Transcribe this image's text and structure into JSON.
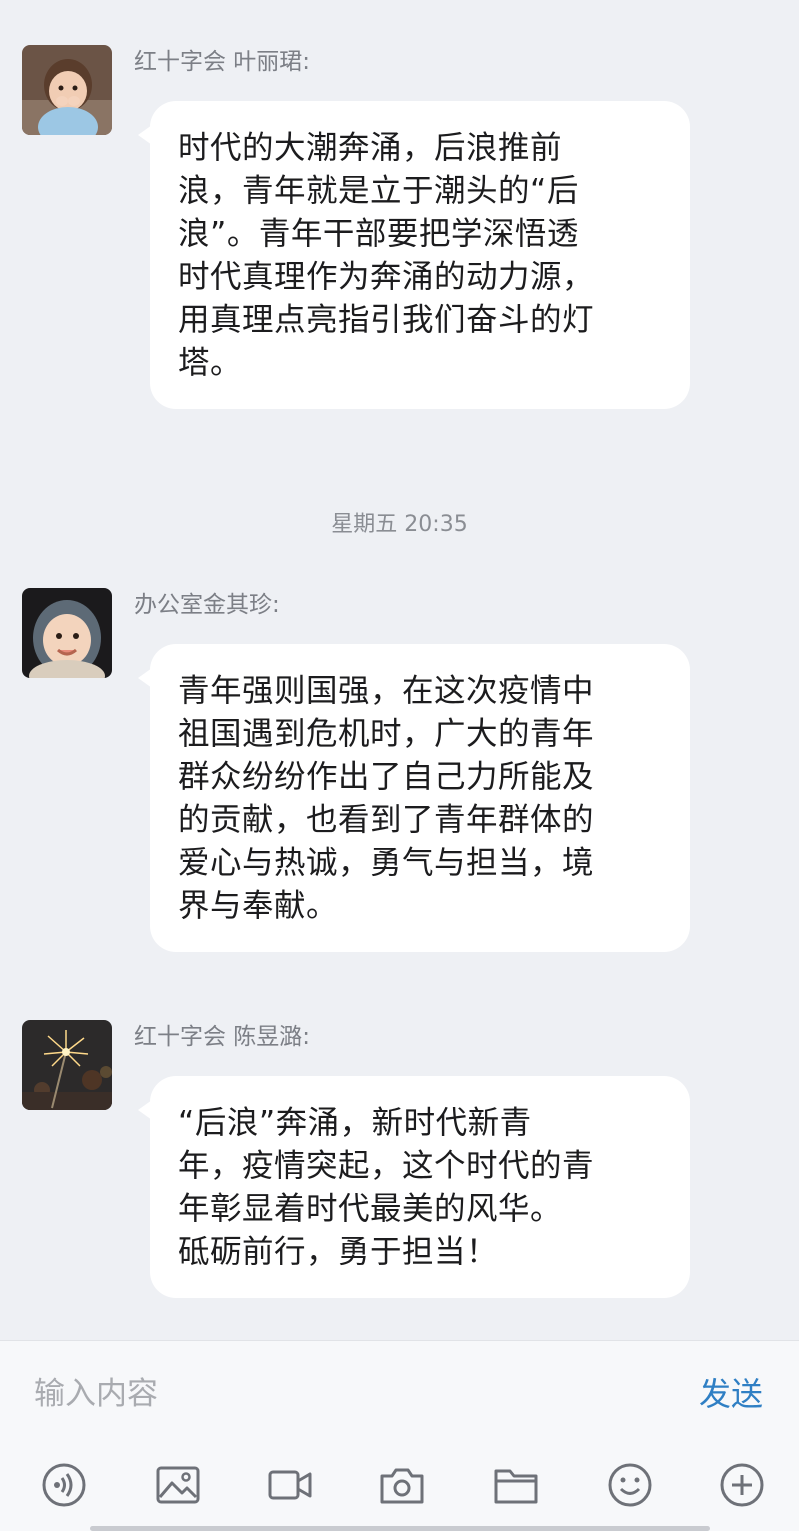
{
  "messages": [
    {
      "sender": "红十字会 叶丽珺:",
      "avatar_icon": "toddler-hands-face-avatar",
      "lines": [
        "时代的大潮奔涌，后浪推前",
        "浪，青年就是立于潮头的“后",
        "浪”。青年干部要把学深悟透",
        "时代真理作为奔涌的动力源，",
        "用真理点亮指引我们奋斗的灯",
        "塔。"
      ]
    },
    {
      "sender": "办公室金其珍:",
      "avatar_icon": "baby-hood-avatar",
      "lines": [
        "青年强则国强，在这次疫情中",
        "祖国遇到危机时，广大的青年",
        "群众纷纷作出了自己力所能及",
        "的贡献，也看到了青年群体的",
        "爱心与热诚，勇气与担当，境",
        "界与奉献。"
      ]
    },
    {
      "sender": "红十字会 陈昱潞:",
      "avatar_icon": "sparkler-avatar",
      "lines": [
        "“后浪”奔涌，新时代新青",
        "年，疫情突起，这个时代的青",
        "年彰显着时代最美的风华。",
        "砥砺前行，勇于担当！"
      ]
    }
  ],
  "timestamp": "星期五 20:35",
  "composer": {
    "placeholder": "输入内容",
    "send_label": "发送"
  },
  "toolbar_icons": [
    "voice-icon",
    "image-icon",
    "video-icon",
    "camera-icon",
    "folder-icon",
    "emoji-icon",
    "plus-icon"
  ],
  "colors": {
    "background": "#eef0f4",
    "bubble": "#ffffff",
    "send": "#2f7fc4",
    "icon": "#6e7178"
  }
}
